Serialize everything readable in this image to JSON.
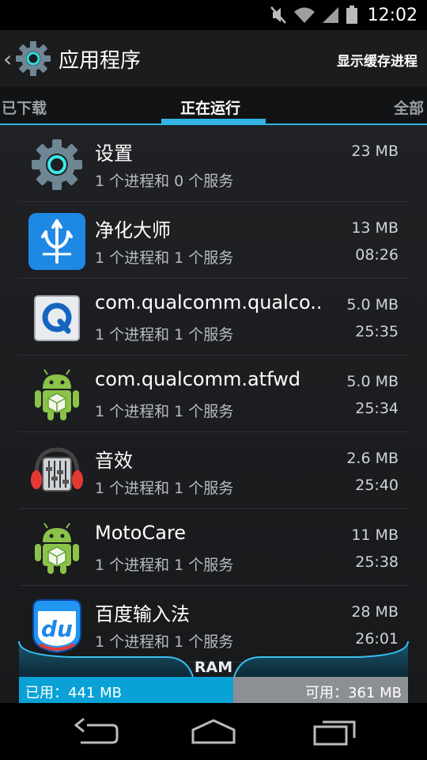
{
  "status_bar": {
    "time": "12:02"
  },
  "action_bar": {
    "title": "应用程序",
    "cached_action": "显示缓存进程"
  },
  "tabs": [
    {
      "label": "已下载"
    },
    {
      "label": "正在运行"
    },
    {
      "label": "全部"
    }
  ],
  "apps": [
    {
      "name": "设置",
      "sub": "1 个进程和 0 个服务",
      "size": "23 MB",
      "time": "",
      "icon": "settings-gear-icon"
    },
    {
      "name": "净化大师",
      "sub": "1 个进程和 1 个服务",
      "size": "13 MB",
      "time": "08:26",
      "icon": "trident-icon"
    },
    {
      "name": "com.qualcomm.qualco..",
      "sub": "1 个进程和 1 个服务",
      "size": "5.0 MB",
      "time": "25:35",
      "icon": "qualcomm-q-icon"
    },
    {
      "name": "com.qualcomm.atfwd",
      "sub": "1 个进程和 1 个服务",
      "size": "5.0 MB",
      "time": "25:34",
      "icon": "android-package-icon"
    },
    {
      "name": "音效",
      "sub": "1 个进程和 1 个服务",
      "size": "2.6 MB",
      "time": "25:40",
      "icon": "equalizer-headphones-icon"
    },
    {
      "name": "MotoCare",
      "sub": "1 个进程和 1 个服务",
      "size": "11 MB",
      "time": "25:38",
      "icon": "android-package-icon"
    },
    {
      "name": "百度输入法",
      "sub": "1 个进程和 1 个服务",
      "size": "28 MB",
      "time": "26:01",
      "icon": "baidu-du-icon"
    }
  ],
  "ram": {
    "label": "RAM",
    "used_label": "已用：441 MB",
    "free_label": "可用：361 MB",
    "used_fraction": 0.55
  }
}
